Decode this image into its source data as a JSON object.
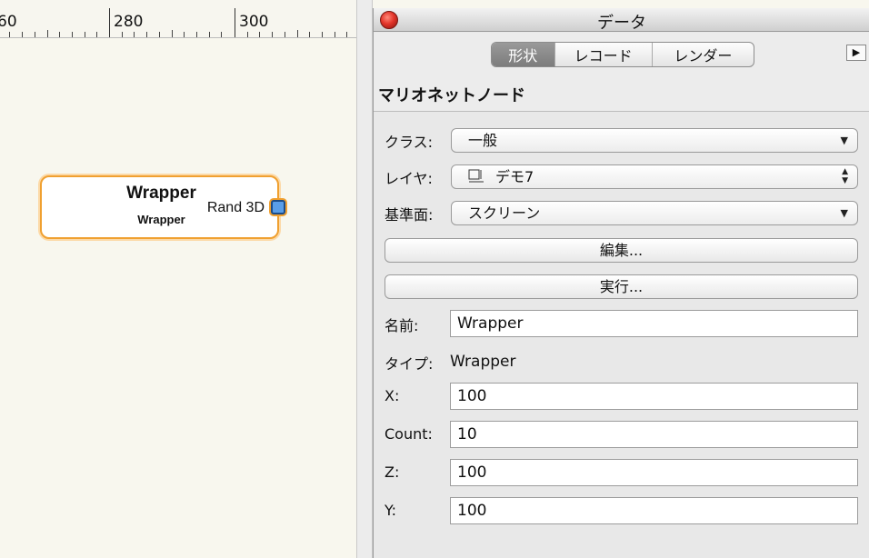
{
  "canvas": {
    "ruler": {
      "labels": [
        "60",
        "280",
        "300"
      ]
    },
    "node": {
      "title": "Wrapper",
      "subtitle": "Wrapper",
      "port_label": "Rand 3D"
    }
  },
  "panel": {
    "window_title": "データ",
    "tabs": [
      {
        "label": "形状",
        "active": true
      },
      {
        "label": "レコード",
        "active": false
      },
      {
        "label": "レンダー",
        "active": false
      }
    ],
    "section_title": "マリオネットノード",
    "class": {
      "label": "クラス:",
      "value": "一般"
    },
    "layer": {
      "label": "レイヤ:",
      "value": "デモ7"
    },
    "plane": {
      "label": "基準面:",
      "value": "スクリーン"
    },
    "edit_button": "編集...",
    "run_button": "実行...",
    "name": {
      "label": "名前:",
      "value": "Wrapper"
    },
    "type": {
      "label": "タイプ:",
      "value": "Wrapper"
    },
    "x": {
      "label": "X:",
      "value": "100"
    },
    "count": {
      "label": "Count:",
      "value": "10"
    },
    "z": {
      "label": "Z:",
      "value": "100"
    },
    "y": {
      "label": "Y:",
      "value": "100"
    }
  },
  "colors": {
    "node_border": "#f0a030",
    "port_fill": "#5a9ee8",
    "close_button": "#e3352a",
    "active_tab": "#8a8a8a"
  },
  "icons": [
    "close-icon",
    "expand-panel-icon",
    "popup-arrow-icon",
    "stepper-arrows-icon",
    "layer-icon",
    "output-port-icon"
  ]
}
